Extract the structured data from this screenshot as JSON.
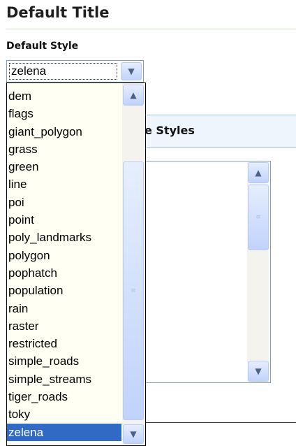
{
  "page": {
    "title": "Default Title"
  },
  "default_style": {
    "label": "Default Style",
    "selected_value": "zelena",
    "options": [
      "dem",
      "flags",
      "giant_polygon",
      "grass",
      "green",
      "line",
      "poi",
      "point",
      "poly_landmarks",
      "polygon",
      "pophatch",
      "population",
      "rain",
      "raster",
      "restricted",
      "simple_roads",
      "simple_streams",
      "tiger_roads",
      "toky",
      "zelena"
    ]
  },
  "panel": {
    "title_visible": "e Styles"
  },
  "icons": {
    "arrow_up": "▲",
    "arrow_down": "▼",
    "grip": "≡"
  }
}
